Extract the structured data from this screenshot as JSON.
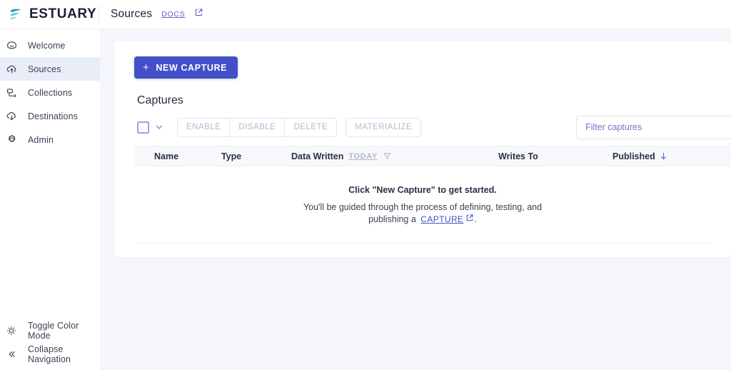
{
  "brand": {
    "name": "ESTUARY",
    "logo_icon": "estuary-logo-icon"
  },
  "topbar": {
    "page_name": "Sources",
    "docs_label": "DOCS",
    "docs_external_icon": "external-link-icon"
  },
  "sidebar": {
    "items": [
      {
        "label": "Welcome",
        "icon": "home-icon",
        "selected": false
      },
      {
        "label": "Sources",
        "icon": "cloud-upload-icon",
        "selected": true
      },
      {
        "label": "Collections",
        "icon": "collections-icon",
        "selected": false
      },
      {
        "label": "Destinations",
        "icon": "cloud-download-icon",
        "selected": false
      },
      {
        "label": "Admin",
        "icon": "gear-icon",
        "selected": false
      }
    ],
    "footer_items": [
      {
        "label": "Toggle Color Mode",
        "icon": "sun-icon"
      },
      {
        "label": "Collapse Navigation",
        "icon": "double-chevron-left-icon"
      }
    ]
  },
  "main": {
    "new_capture_label": "NEW CAPTURE",
    "new_capture_plus": "+",
    "section_title": "Captures",
    "select_all_checkbox": "unchecked",
    "select_menu_icon": "chevron-down-icon",
    "actions": [
      {
        "label": "ENABLE",
        "disabled": true
      },
      {
        "label": "DISABLE",
        "disabled": true
      },
      {
        "label": "DELETE",
        "disabled": true
      }
    ],
    "materialize_label": "MATERIALIZE",
    "filter": {
      "placeholder": "Filter captures",
      "value": ""
    },
    "table": {
      "columns": [
        {
          "label": "Name"
        },
        {
          "label": "Type"
        },
        {
          "label": "Data Written"
        },
        {
          "label": "Writes To"
        },
        {
          "label": "Published"
        }
      ],
      "data_written_chip": "TODAY",
      "data_written_filter_icon": "funnel-icon",
      "published_sort_icon": "arrow-down-icon"
    },
    "empty_state": {
      "title": "Click \"New Capture\" to get started.",
      "line1": "You'll be guided through the process of defining, testing, and",
      "line2_prefix": "publishing a",
      "link_label": "CAPTURE",
      "link_external_icon": "external-link-icon",
      "line2_suffix": "."
    }
  },
  "colors": {
    "accent": "#4350c8",
    "link": "#5b63c4",
    "page_bg": "#f4f6fb",
    "selected_nav_bg": "#e9edf8",
    "disabled_text": "#b6bace"
  }
}
